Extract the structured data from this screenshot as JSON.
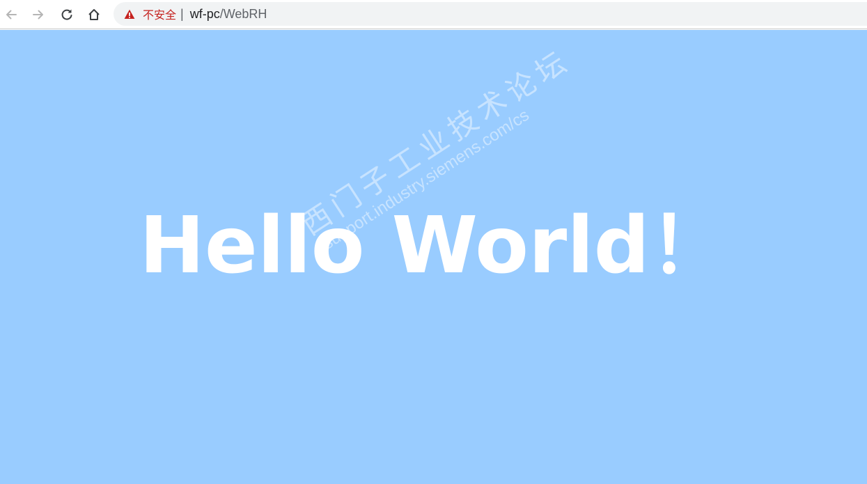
{
  "browser": {
    "security_label": "不安全",
    "separator": "|",
    "url_host": "wf-pc",
    "url_path": "/WebRH",
    "icons": {
      "back": "arrow-left-icon",
      "forward": "arrow-right-icon",
      "reload": "reload-icon",
      "home": "home-icon",
      "security": "warning-triangle-icon"
    }
  },
  "page": {
    "headline": "Hello World！",
    "background_color": "#99ccff",
    "text_color": "#ffffff"
  },
  "watermark": {
    "line1": "西门子工业技术论坛",
    "line2": "support.industry.siemens.com/cs"
  }
}
